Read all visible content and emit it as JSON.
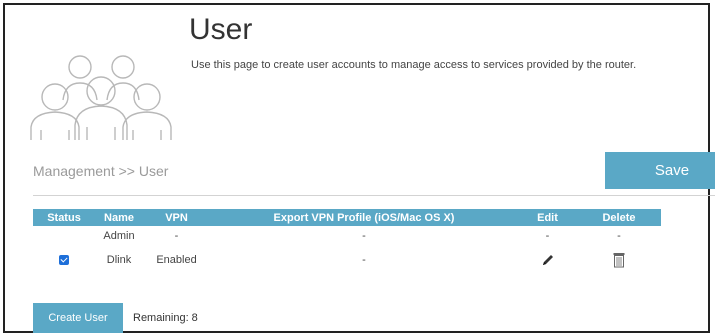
{
  "header": {
    "title": "User",
    "description": "Use this page to create user accounts to manage access to services provided by the router."
  },
  "breadcrumb": "Management >> User",
  "save_label": "Save",
  "table": {
    "headers": {
      "status": "Status",
      "name": "Name",
      "vpn": "VPN",
      "export": "Export VPN Profile (iOS/Mac OS X)",
      "edit": "Edit",
      "delete": "Delete"
    },
    "rows": [
      {
        "status_checked": false,
        "name": "Admin",
        "vpn": "-",
        "export": "-",
        "edit": "-",
        "delete": "-"
      },
      {
        "status_checked": true,
        "name": "Dlink",
        "vpn": "Enabled",
        "export": "-",
        "edit_icon": "pencil-icon",
        "delete_icon": "trash-icon"
      }
    ]
  },
  "create_user_label": "Create User",
  "remaining_label": "Remaining:",
  "remaining_count": "8",
  "colors": {
    "accent": "#5aa8c6",
    "checkbox": "#1e6fd9"
  }
}
